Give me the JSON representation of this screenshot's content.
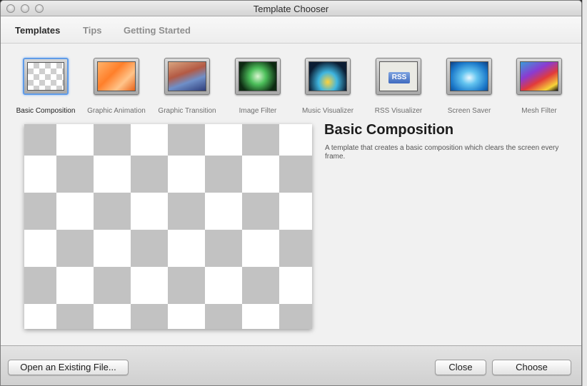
{
  "window": {
    "title": "Template Chooser"
  },
  "tabs": [
    {
      "label": "Templates",
      "active": true
    },
    {
      "label": "Tips",
      "active": false
    },
    {
      "label": "Getting Started",
      "active": false
    }
  ],
  "templates": [
    {
      "label": "Basic Composition",
      "thumb": "checker",
      "selected": true
    },
    {
      "label": "Graphic Animation",
      "thumb": "orange"
    },
    {
      "label": "Graphic Transition",
      "thumb": "transition"
    },
    {
      "label": "Image Filter",
      "thumb": "imgfilter"
    },
    {
      "label": "Music Visualizer",
      "thumb": "music"
    },
    {
      "label": "RSS Visualizer",
      "thumb": "rss",
      "badge": "RSS"
    },
    {
      "label": "Screen Saver",
      "thumb": "screensaver"
    },
    {
      "label": "Mesh Filter",
      "thumb": "mesh"
    }
  ],
  "detail": {
    "title": "Basic Composition",
    "description": "A template that creates a basic composition which clears the screen every frame."
  },
  "buttons": {
    "open_label": "Open an Existing File...",
    "close_label": "Close",
    "choose_label": "Choose"
  },
  "colors": {
    "selection": "#5f9be8",
    "checker_dark": "#c2c2c2",
    "checker_light": "#ffffff"
  }
}
